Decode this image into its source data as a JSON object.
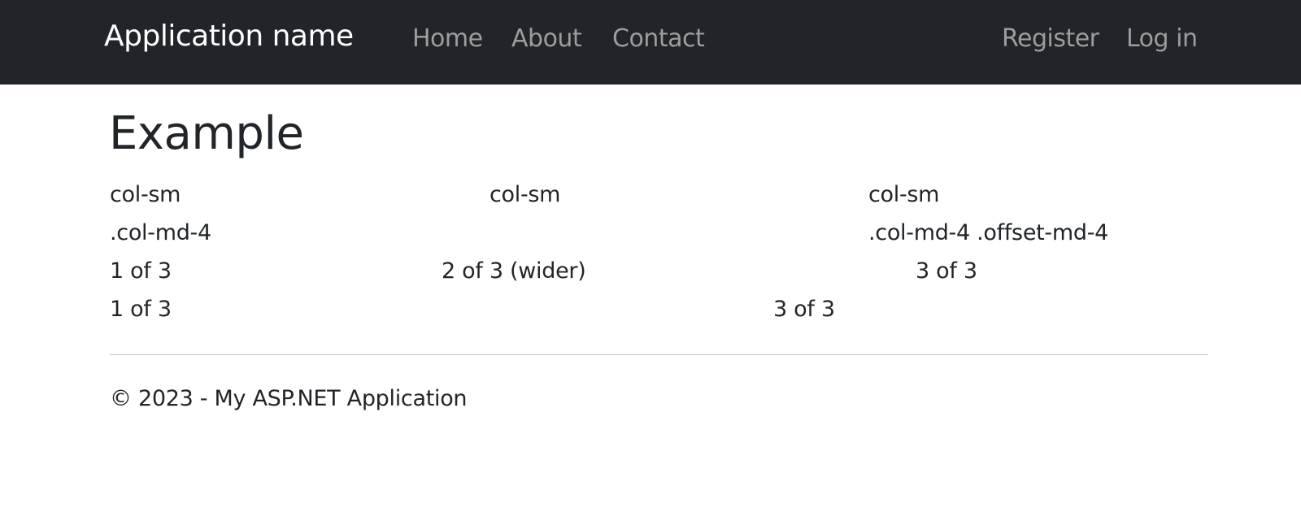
{
  "navbar": {
    "brand": "Application name",
    "links": [
      "Home",
      "About",
      "Contact"
    ],
    "right_links": [
      "Register",
      "Log in"
    ]
  },
  "main": {
    "heading": "Example",
    "rows": [
      [
        "col-sm",
        "col-sm",
        "col-sm"
      ],
      [
        ".col-md-4",
        ".col-md-4 .offset-md-4"
      ],
      [
        "1 of 3",
        "2 of 3 (wider)",
        "3 of 3"
      ],
      [
        "1 of 3",
        "3 of 3"
      ]
    ]
  },
  "footer": {
    "text": "© 2023 - My ASP.NET Application"
  }
}
